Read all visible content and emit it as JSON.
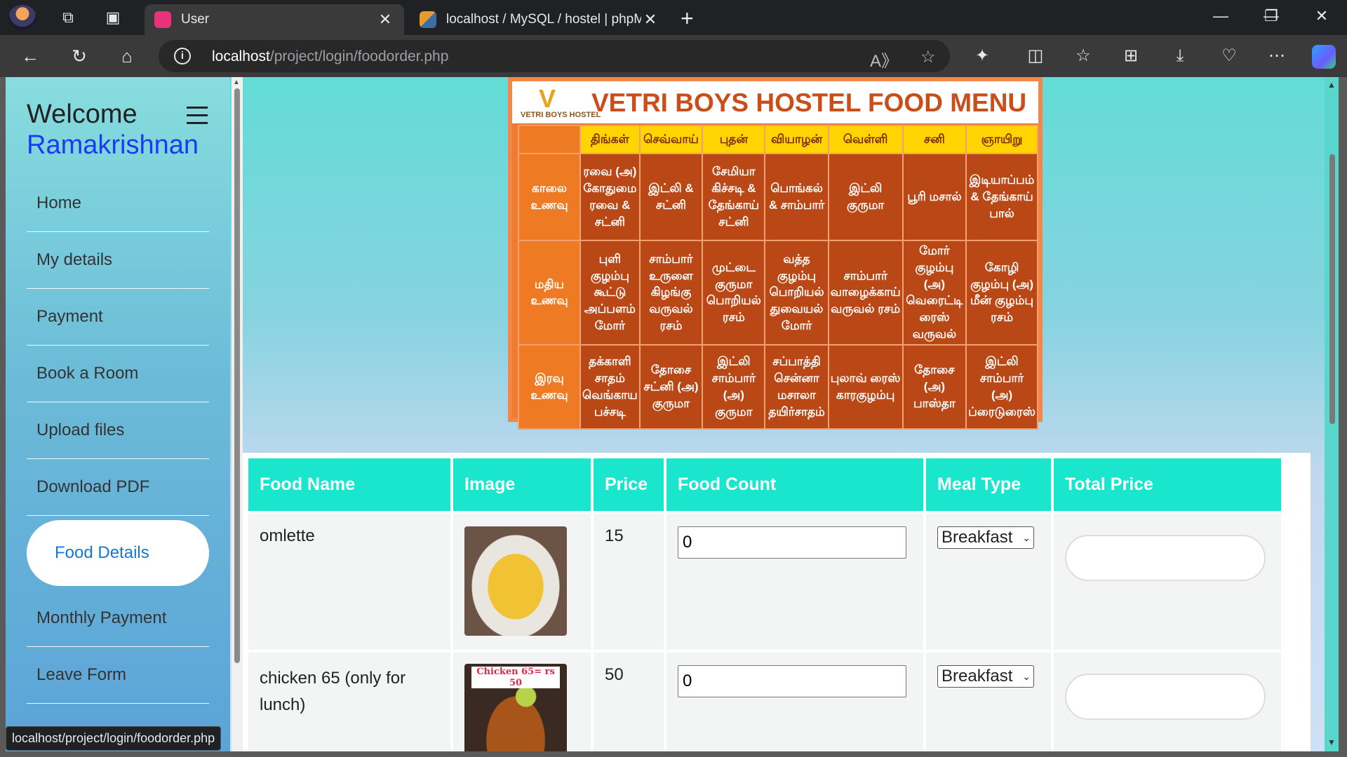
{
  "browser": {
    "tabs": [
      {
        "title": "User",
        "active": true,
        "favicon_color": "#e8337a"
      },
      {
        "title": "localhost / MySQL / hostel | phpM",
        "active": false,
        "favicon_color": "#e89b2c"
      }
    ],
    "url_host": "localhost",
    "url_path": "/project/login/foodorder.php",
    "status_url": "localhost/project/login/foodorder.php"
  },
  "sidebar": {
    "welcome": "Welcome",
    "username": "Ramakrishnan",
    "items": [
      {
        "label": "Home",
        "active": false
      },
      {
        "label": "My details",
        "active": false
      },
      {
        "label": "Payment",
        "active": false
      },
      {
        "label": "Book a Room",
        "active": false
      },
      {
        "label": "Upload files",
        "active": false
      },
      {
        "label": "Download PDF",
        "active": false
      },
      {
        "label": "Food Details",
        "active": true
      },
      {
        "label": "Monthly Payment",
        "active": false
      },
      {
        "label": "Leave Form",
        "active": false
      }
    ]
  },
  "menu_image": {
    "logo_text": "VETRI BOYS HOSTEL",
    "title": "VETRI BOYS HOSTEL FOOD MENU",
    "days": [
      "திங்கள்",
      "செவ்வாய்",
      "புதன்",
      "வியாழன்",
      "வெள்ளி",
      "சனி",
      "ஞாயிறு"
    ],
    "meals": [
      {
        "name": "காலை உணவு",
        "items": [
          "ரவை (அ) கோதுமை ரவை & சட்னி",
          "இட்லி & சட்னி",
          "சேமியா கிச்சடி & தேங்காய் சட்னி",
          "பொங்கல் & சாம்பார்",
          "இட்லி குருமா",
          "பூரி மசால்",
          "இடியாப்பம் & தேங்காய் பால்"
        ]
      },
      {
        "name": "மதிய உணவு",
        "items": [
          "புளி குழம்பு கூட்டு அப்பளம் மோர்",
          "சாம்பார் உருளை கிழங்கு வருவல் ரசம்",
          "முட்டை குருமா பொறியல் ரசம்",
          "வத்த குழம்பு பொறியல் துவையல் மோர்",
          "சாம்பார் வாழைக்காய் வருவல் ரசம்",
          "மோர் குழம்பு (அ) வெரைட்டி ரைஸ் வருவல்",
          "கோழி குழம்பு (அ) மீன் குழம்பு ரசம்"
        ]
      },
      {
        "name": "இரவு உணவு",
        "items": [
          "தக்காளி சாதம் வெங்காய பச்சடி",
          "தோசை சட்னி (அ) குருமா",
          "இட்லி சாம்பார் (அ) குருமா",
          "சப்பாத்தி சென்னா மசாலா தயிர்சாதம்",
          "புலாவ் ரைஸ் காரகுழம்பு",
          "தோசை (அ) பாஸ்தா",
          "இட்லி சாம்பார் (அ) ப்ரைடுரைஸ்"
        ]
      }
    ]
  },
  "food_table": {
    "headers": [
      "Food Name",
      "Image",
      "Price",
      "Food Count",
      "Meal Type",
      "Total Price"
    ],
    "rows": [
      {
        "name": "omlette",
        "price": "15",
        "count": "0",
        "meal_type": "Breakfast",
        "image_label": ""
      },
      {
        "name": "chicken 65 (only for lunch)",
        "price": "50",
        "count": "0",
        "meal_type": "Breakfast",
        "image_label": "Chicken 65= rs 50"
      }
    ]
  }
}
